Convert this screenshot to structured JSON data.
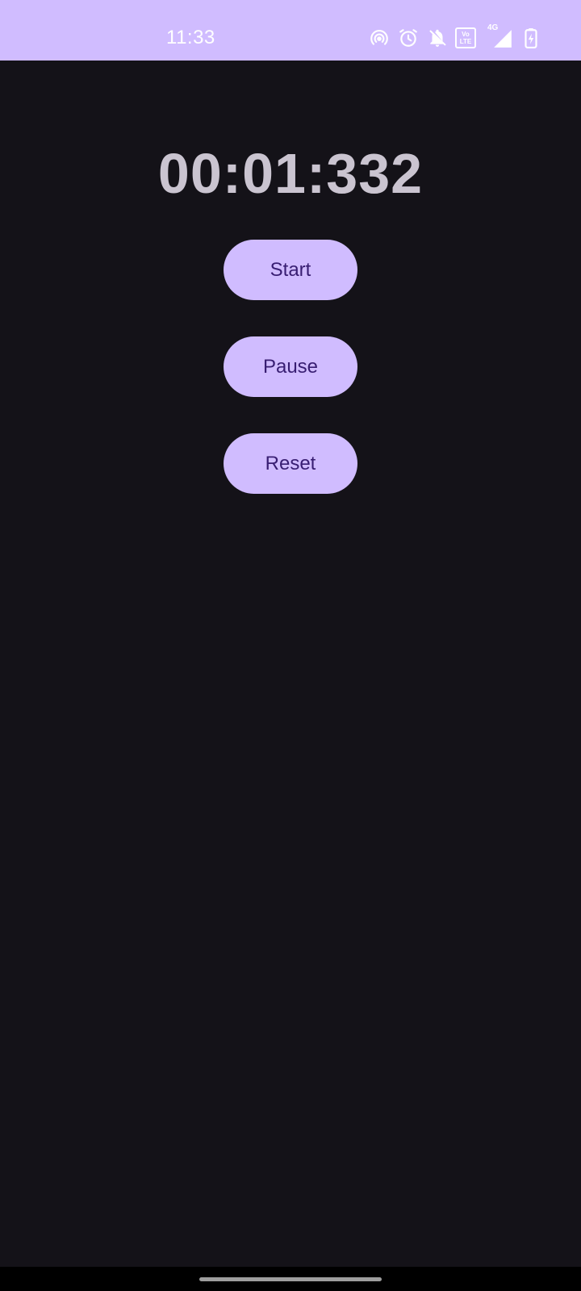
{
  "status_bar": {
    "time": "11:33",
    "icons": [
      "hotspot-icon",
      "alarm-icon",
      "notifications-off-icon",
      "volte-icon",
      "signal-4g-icon",
      "battery-charging-icon"
    ],
    "volte_top": "Vo",
    "volte_bottom": "LTE",
    "network_label": "4G",
    "background_color": "#d0bcff"
  },
  "stopwatch": {
    "display": "00:01:332"
  },
  "controls": {
    "start_label": "Start",
    "pause_label": "Pause",
    "reset_label": "Reset",
    "button_color": "#d0bcff",
    "button_text_color": "#381e72"
  },
  "theme": {
    "background": "#141218",
    "timer_text_color": "#cac4d0"
  }
}
